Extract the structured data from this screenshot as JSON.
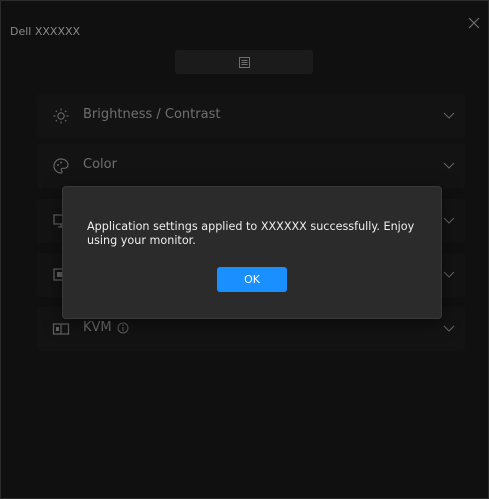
{
  "window": {
    "title": "Dell XXXXXX"
  },
  "sections": [
    {
      "label": "Brightness / Contrast",
      "icon": "brightness-icon"
    },
    {
      "label": "Color",
      "icon": "palette-icon"
    },
    {
      "label": "",
      "icon": "display-icon"
    },
    {
      "label": "",
      "icon": "input-icon"
    },
    {
      "label": "KVM",
      "icon": "kvm-icon",
      "info_icon": "info-icon"
    }
  ],
  "dialog": {
    "message": "Application settings applied to XXXXXX successfully. Enjoy using your monitor.",
    "ok_label": "OK"
  },
  "colors": {
    "accent": "#1a8fff",
    "background": "#171717",
    "dialog_bg": "#2b2b2b"
  }
}
